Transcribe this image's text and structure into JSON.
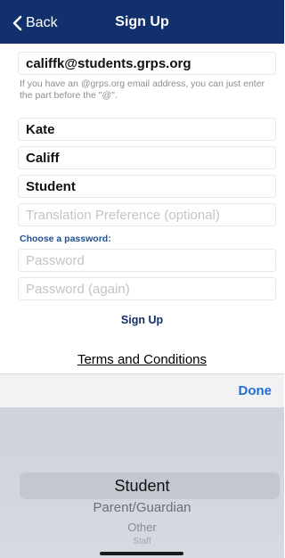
{
  "navbar": {
    "back_label": "Back",
    "title": "Sign Up"
  },
  "form": {
    "email_value": "califfk@students.grps.org",
    "email_hint": "If you have an @grps.org email address, you can just enter the part before the \"@\".",
    "first_name_value": "Kate",
    "last_name_value": "Califf",
    "role_value": "Student",
    "translation_placeholder": "Translation Preference (optional)",
    "password_section_label": "Choose a password:",
    "password_placeholder": "Password",
    "password_again_placeholder": "Password (again)",
    "signup_label": "Sign Up",
    "terms_label": "Terms and Conditions"
  },
  "toolbar": {
    "done_label": "Done"
  },
  "picker": {
    "selected": "Student",
    "options": [
      "Parent/Guardian",
      "Other",
      "Staff"
    ]
  },
  "colors": {
    "navbar": "#12306b",
    "accent_done": "#1f6fd6",
    "section_label": "#1b4f9c"
  }
}
